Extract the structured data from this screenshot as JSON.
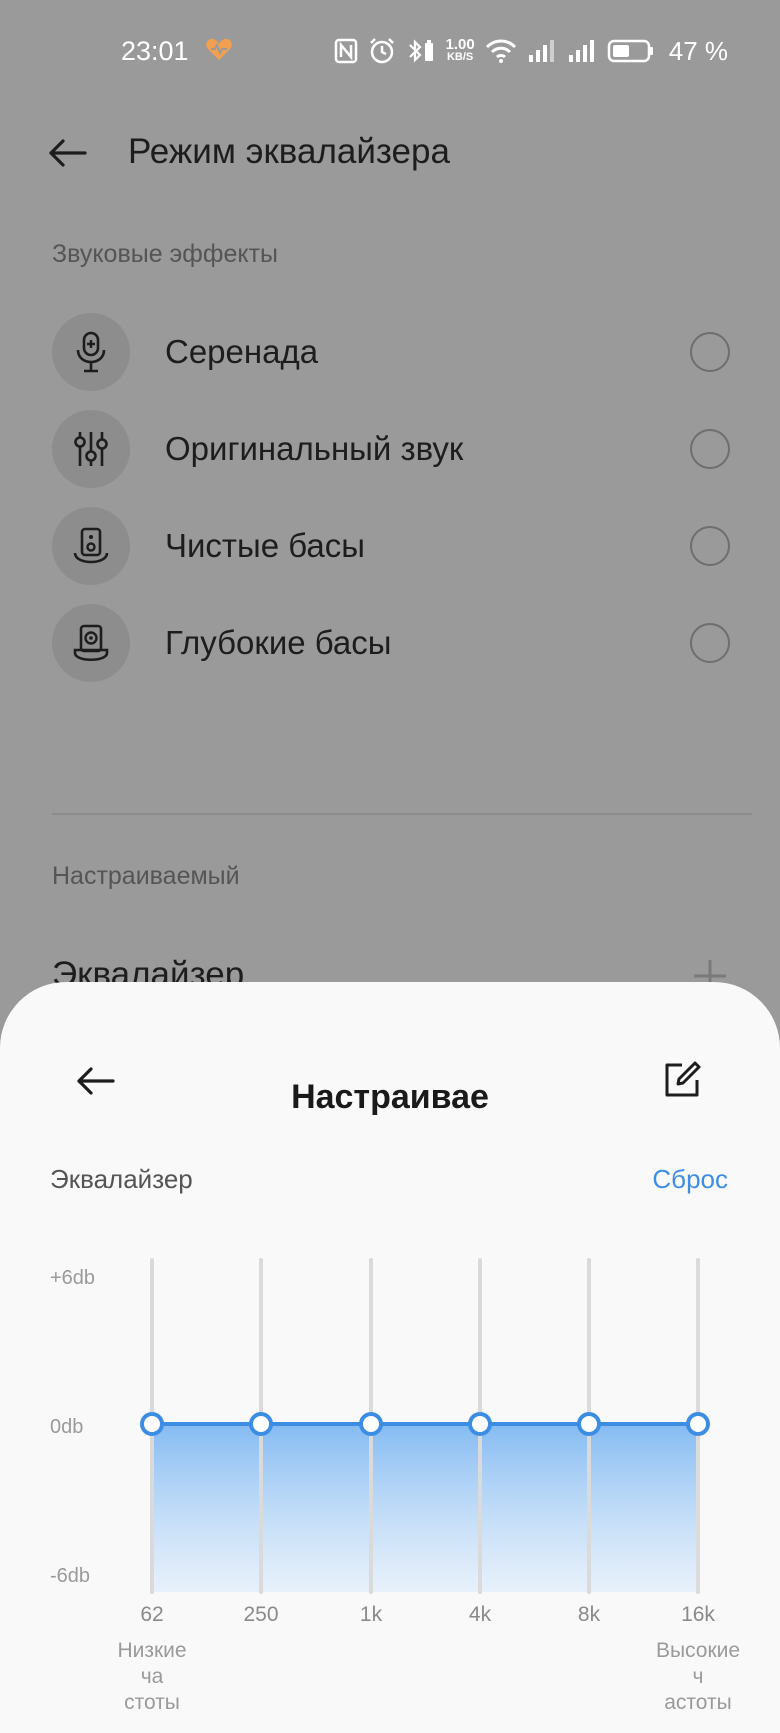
{
  "status_bar": {
    "time": "23:01",
    "speed_value": "1.00",
    "speed_unit": "KB/S",
    "battery_percent": "47 %"
  },
  "header": {
    "title": "Режим эквалайзера"
  },
  "sound_effects": {
    "section_title": "Звуковые эффекты",
    "items": [
      {
        "label": "Серенада",
        "icon": "microphone-icon",
        "selected": false
      },
      {
        "label": "Оригинальный звук",
        "icon": "sliders-icon",
        "selected": false
      },
      {
        "label": "Чистые басы",
        "icon": "speaker-icon",
        "selected": false
      },
      {
        "label": "Глубокие басы",
        "icon": "subwoofer-icon",
        "selected": false
      }
    ]
  },
  "custom": {
    "section_title": "Настраиваемый",
    "equalizer_label": "Эквалайзер"
  },
  "sheet": {
    "title": "Настраивае",
    "equalizer_heading": "Эквалайзер",
    "reset_label": "Сброс"
  },
  "chart_data": {
    "type": "line",
    "x": [
      "62",
      "250",
      "1k",
      "4k",
      "8k",
      "16k"
    ],
    "values": [
      0,
      0,
      0,
      0,
      0,
      0
    ],
    "y_tick_labels": [
      "+6db",
      "0db",
      "-6db"
    ],
    "ylim": [
      -6,
      6
    ],
    "low_freq_label": "Низкие ча стоты",
    "high_freq_label": "Высокие ч астоты",
    "accent_color": "#3d8ee2"
  }
}
